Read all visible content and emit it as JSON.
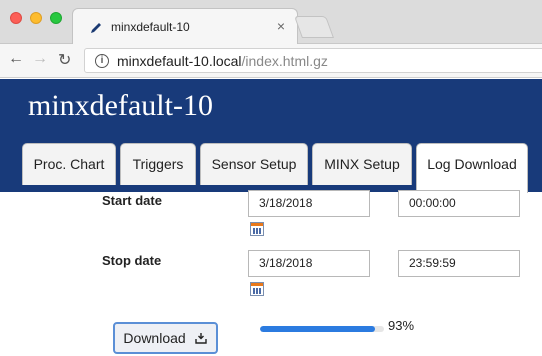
{
  "browser": {
    "tab_title": "minxdefault-10",
    "tab_close": "×",
    "url_host": "minxdefault-10.local",
    "url_path": "/index.html.gz"
  },
  "header": {
    "site_title": "minxdefault-10",
    "tabs": [
      {
        "label": "Proc. Chart"
      },
      {
        "label": "Triggers"
      },
      {
        "label": "Sensor Setup"
      },
      {
        "label": "MINX Setup"
      },
      {
        "label": "Log Download"
      }
    ],
    "active_tab": "Log Download"
  },
  "form": {
    "start_label": "Start date",
    "start_date": "3/18/2018",
    "start_time": "00:00:00",
    "stop_label": "Stop date",
    "stop_date": "3/18/2018",
    "stop_time": "23:59:59"
  },
  "download": {
    "button_label": "Download",
    "progress_percent": 93,
    "progress_text": "93%"
  },
  "colors": {
    "header_bg": "#183a7a",
    "progress_fill": "#2b7be0"
  }
}
